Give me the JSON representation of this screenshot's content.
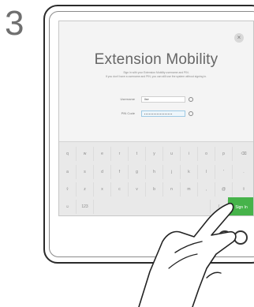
{
  "step_number": "3",
  "screen": {
    "close_label": "×",
    "title": "Extension Mobility",
    "subtitle_line1": "Sign in with your Extension Mobility username and PIN.",
    "subtitle_line2": "If you don't have a username and PIN, you can still use the system without signing in.",
    "username_label": "Username",
    "username_value": "Ilse",
    "pin_label": "PIN Code"
  },
  "keyboard": {
    "row1": [
      "q",
      "w",
      "e",
      "r",
      "t",
      "y",
      "u",
      "i",
      "o",
      "p",
      "⌫"
    ],
    "row2": [
      "a",
      "s",
      "d",
      "f",
      "g",
      "h",
      "j",
      "k",
      "l",
      "'",
      "."
    ],
    "row3": [
      "⇧",
      "z",
      "x",
      "c",
      "v",
      "b",
      "n",
      "m",
      ",",
      "@",
      "⇧"
    ],
    "row4": [
      "☺",
      "123",
      "/"
    ],
    "sign_in_label": "Sign In"
  },
  "colors": {
    "accent_green": "#46b34a",
    "frame": "#2a2a2a",
    "screen_bg": "#f4f4f4"
  }
}
